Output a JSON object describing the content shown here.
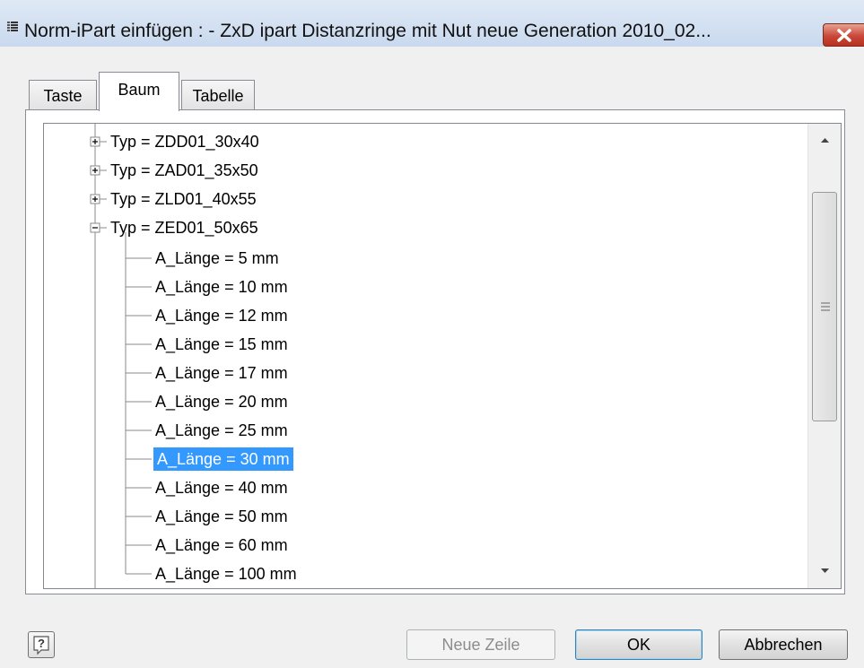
{
  "window": {
    "title": "Norm-iPart einfügen : - ZxD ipart Distanzringe mit Nut neue Generation 2010_02...",
    "close_symbol": "x"
  },
  "tabs": [
    {
      "label": "Taste",
      "active": false
    },
    {
      "label": "Baum",
      "active": true
    },
    {
      "label": "Tabelle",
      "active": false
    }
  ],
  "tree": {
    "types": [
      {
        "label": "Typ = ZDD01_30x40",
        "expanded": false
      },
      {
        "label": "Typ = ZAD01_35x50",
        "expanded": false
      },
      {
        "label": "Typ = ZLD01_40x55",
        "expanded": false
      },
      {
        "label": "Typ = ZED01_50x65",
        "expanded": true
      }
    ],
    "children": [
      {
        "label": "A_Länge = 5 mm",
        "selected": false
      },
      {
        "label": "A_Länge = 10 mm",
        "selected": false
      },
      {
        "label": "A_Länge = 12 mm",
        "selected": false
      },
      {
        "label": "A_Länge = 15 mm",
        "selected": false
      },
      {
        "label": "A_Länge = 17 mm",
        "selected": false
      },
      {
        "label": "A_Länge = 20 mm",
        "selected": false
      },
      {
        "label": "A_Länge = 25 mm",
        "selected": false
      },
      {
        "label": "A_Länge = 30 mm",
        "selected": true
      },
      {
        "label": "A_Länge = 40 mm",
        "selected": false
      },
      {
        "label": "A_Länge = 50 mm",
        "selected": false
      },
      {
        "label": "A_Länge = 60 mm",
        "selected": false
      },
      {
        "label": "A_Länge = 100 mm",
        "selected": false
      }
    ],
    "selection_color": "#3399ff"
  },
  "buttons": {
    "neue_zeile": "Neue Zeile",
    "ok": "OK",
    "abbrechen": "Abbrechen",
    "help_symbol": "?"
  }
}
